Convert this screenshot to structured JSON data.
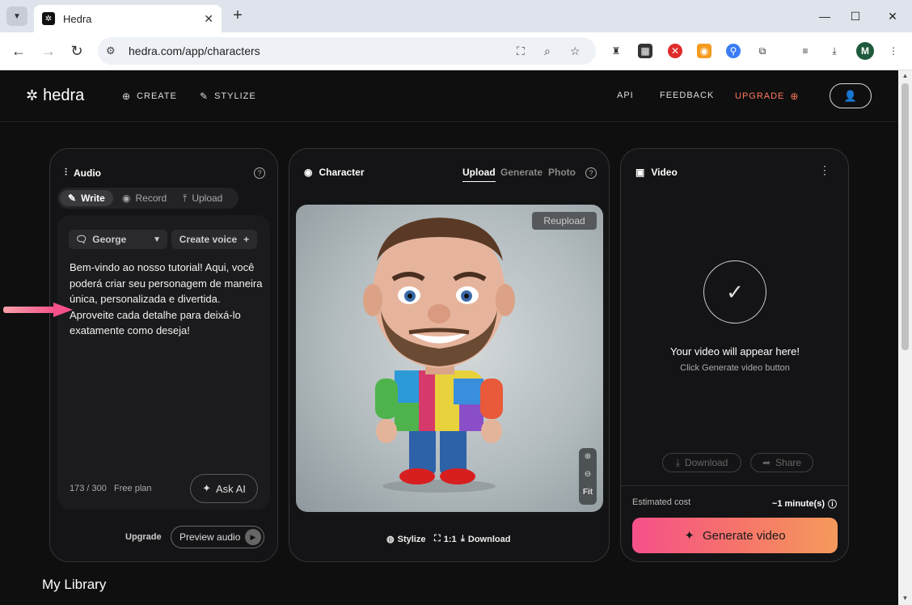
{
  "browser": {
    "tab_title": "Hedra",
    "url": "hedra.com/app/characters",
    "profile_initial": "M"
  },
  "nav": {
    "logo": "hedra",
    "create": "CREATE",
    "stylize": "STYLIZE",
    "api": "API",
    "feedback": "FEEDBACK",
    "upgrade": "UPGRADE"
  },
  "audio": {
    "title": "Audio",
    "tabs": [
      "Write",
      "Record",
      "Upload"
    ],
    "active_tab": "Write",
    "voice": "George",
    "create_voice": "Create voice",
    "script": "Bem-vindo ao nosso tutorial! Aqui, você poderá criar seu personagem de maneira única, personalizada e divertida. Aproveite cada detalhe para deixá-lo exatamente como deseja!",
    "counter": "173 / 300",
    "plan": "Free plan",
    "ask_ai": "Ask AI",
    "upgrade": "Upgrade",
    "preview": "Preview audio"
  },
  "character": {
    "title": "Character",
    "tabs": [
      "Upload",
      "Generate",
      "Photo"
    ],
    "active_tab": "Upload",
    "reupload": "Reupload",
    "zoom_fit": "Fit",
    "stylize": "Stylize",
    "ratio": "1:1",
    "download": "Download"
  },
  "video": {
    "title": "Video",
    "placeholder_title": "Your video will appear here!",
    "placeholder_sub": "Click Generate video button",
    "download": "Download",
    "share": "Share",
    "est_label": "Estimated cost",
    "est_value": "~1 minute(s)",
    "generate": "Generate video"
  },
  "library_title": "My Library",
  "colors": {
    "accent_gradient_start": "#f5508a",
    "accent_gradient_end": "#f59a5b",
    "upgrade": "#ff7a5c"
  }
}
